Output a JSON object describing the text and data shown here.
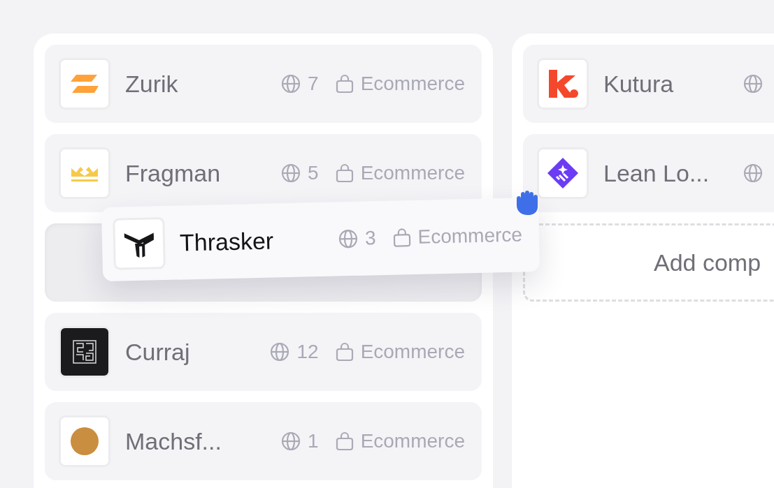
{
  "columns": [
    {
      "items": [
        {
          "kind": "card",
          "logo": {
            "kind": "zurik"
          },
          "name": "Zurik",
          "sites": "7",
          "category": "Ecommerce"
        },
        {
          "kind": "card",
          "logo": {
            "kind": "fragman"
          },
          "name": "Fragman",
          "sites": "5",
          "category": "Ecommerce"
        },
        {
          "kind": "drop_placeholder"
        },
        {
          "kind": "card",
          "logo": {
            "kind": "curraj"
          },
          "name": "Curraj",
          "sites": "12",
          "category": "Ecommerce"
        },
        {
          "kind": "card",
          "logo": {
            "kind": "avatar"
          },
          "name": "Machsf...",
          "sites": "1",
          "category": "Ecommerce"
        }
      ]
    },
    {
      "items": [
        {
          "kind": "card",
          "logo": {
            "kind": "kutura"
          },
          "name": "Kutura"
        },
        {
          "kind": "card",
          "logo": {
            "kind": "leanlo"
          },
          "name": "Lean Lo..."
        },
        {
          "kind": "add_zone",
          "label": "Add comp"
        }
      ]
    }
  ],
  "dragging": {
    "logo": {
      "kind": "thrasker"
    },
    "name": "Thrasker",
    "sites": "3",
    "category": "Ecommerce"
  }
}
